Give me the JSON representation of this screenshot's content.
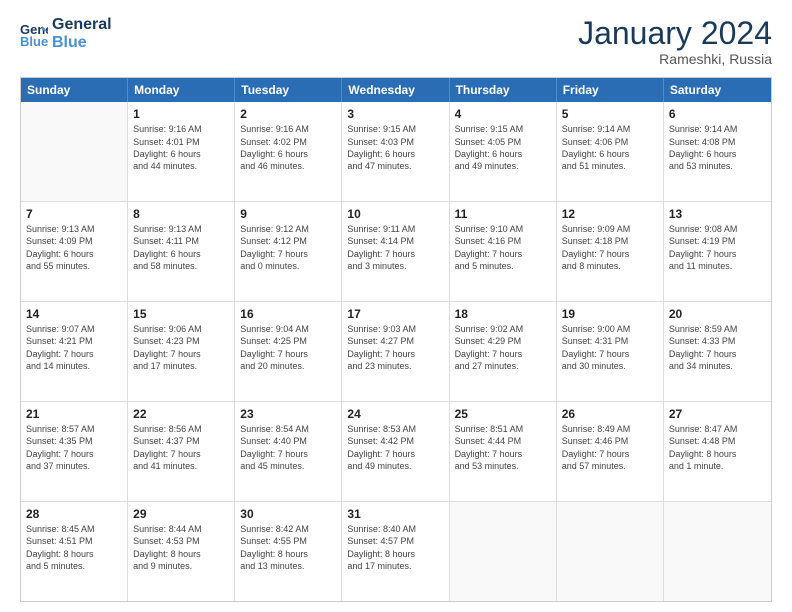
{
  "header": {
    "logo_line1": "General",
    "logo_line2": "Blue",
    "month": "January 2024",
    "location": "Rameshki, Russia"
  },
  "weekdays": [
    "Sunday",
    "Monday",
    "Tuesday",
    "Wednesday",
    "Thursday",
    "Friday",
    "Saturday"
  ],
  "weeks": [
    [
      {
        "day": "",
        "info": ""
      },
      {
        "day": "1",
        "info": "Sunrise: 9:16 AM\nSunset: 4:01 PM\nDaylight: 6 hours\nand 44 minutes."
      },
      {
        "day": "2",
        "info": "Sunrise: 9:16 AM\nSunset: 4:02 PM\nDaylight: 6 hours\nand 46 minutes."
      },
      {
        "day": "3",
        "info": "Sunrise: 9:15 AM\nSunset: 4:03 PM\nDaylight: 6 hours\nand 47 minutes."
      },
      {
        "day": "4",
        "info": "Sunrise: 9:15 AM\nSunset: 4:05 PM\nDaylight: 6 hours\nand 49 minutes."
      },
      {
        "day": "5",
        "info": "Sunrise: 9:14 AM\nSunset: 4:06 PM\nDaylight: 6 hours\nand 51 minutes."
      },
      {
        "day": "6",
        "info": "Sunrise: 9:14 AM\nSunset: 4:08 PM\nDaylight: 6 hours\nand 53 minutes."
      }
    ],
    [
      {
        "day": "7",
        "info": "Sunrise: 9:13 AM\nSunset: 4:09 PM\nDaylight: 6 hours\nand 55 minutes."
      },
      {
        "day": "8",
        "info": "Sunrise: 9:13 AM\nSunset: 4:11 PM\nDaylight: 6 hours\nand 58 minutes."
      },
      {
        "day": "9",
        "info": "Sunrise: 9:12 AM\nSunset: 4:12 PM\nDaylight: 7 hours\nand 0 minutes."
      },
      {
        "day": "10",
        "info": "Sunrise: 9:11 AM\nSunset: 4:14 PM\nDaylight: 7 hours\nand 3 minutes."
      },
      {
        "day": "11",
        "info": "Sunrise: 9:10 AM\nSunset: 4:16 PM\nDaylight: 7 hours\nand 5 minutes."
      },
      {
        "day": "12",
        "info": "Sunrise: 9:09 AM\nSunset: 4:18 PM\nDaylight: 7 hours\nand 8 minutes."
      },
      {
        "day": "13",
        "info": "Sunrise: 9:08 AM\nSunset: 4:19 PM\nDaylight: 7 hours\nand 11 minutes."
      }
    ],
    [
      {
        "day": "14",
        "info": "Sunrise: 9:07 AM\nSunset: 4:21 PM\nDaylight: 7 hours\nand 14 minutes."
      },
      {
        "day": "15",
        "info": "Sunrise: 9:06 AM\nSunset: 4:23 PM\nDaylight: 7 hours\nand 17 minutes."
      },
      {
        "day": "16",
        "info": "Sunrise: 9:04 AM\nSunset: 4:25 PM\nDaylight: 7 hours\nand 20 minutes."
      },
      {
        "day": "17",
        "info": "Sunrise: 9:03 AM\nSunset: 4:27 PM\nDaylight: 7 hours\nand 23 minutes."
      },
      {
        "day": "18",
        "info": "Sunrise: 9:02 AM\nSunset: 4:29 PM\nDaylight: 7 hours\nand 27 minutes."
      },
      {
        "day": "19",
        "info": "Sunrise: 9:00 AM\nSunset: 4:31 PM\nDaylight: 7 hours\nand 30 minutes."
      },
      {
        "day": "20",
        "info": "Sunrise: 8:59 AM\nSunset: 4:33 PM\nDaylight: 7 hours\nand 34 minutes."
      }
    ],
    [
      {
        "day": "21",
        "info": "Sunrise: 8:57 AM\nSunset: 4:35 PM\nDaylight: 7 hours\nand 37 minutes."
      },
      {
        "day": "22",
        "info": "Sunrise: 8:56 AM\nSunset: 4:37 PM\nDaylight: 7 hours\nand 41 minutes."
      },
      {
        "day": "23",
        "info": "Sunrise: 8:54 AM\nSunset: 4:40 PM\nDaylight: 7 hours\nand 45 minutes."
      },
      {
        "day": "24",
        "info": "Sunrise: 8:53 AM\nSunset: 4:42 PM\nDaylight: 7 hours\nand 49 minutes."
      },
      {
        "day": "25",
        "info": "Sunrise: 8:51 AM\nSunset: 4:44 PM\nDaylight: 7 hours\nand 53 minutes."
      },
      {
        "day": "26",
        "info": "Sunrise: 8:49 AM\nSunset: 4:46 PM\nDaylight: 7 hours\nand 57 minutes."
      },
      {
        "day": "27",
        "info": "Sunrise: 8:47 AM\nSunset: 4:48 PM\nDaylight: 8 hours\nand 1 minute."
      }
    ],
    [
      {
        "day": "28",
        "info": "Sunrise: 8:45 AM\nSunset: 4:51 PM\nDaylight: 8 hours\nand 5 minutes."
      },
      {
        "day": "29",
        "info": "Sunrise: 8:44 AM\nSunset: 4:53 PM\nDaylight: 8 hours\nand 9 minutes."
      },
      {
        "day": "30",
        "info": "Sunrise: 8:42 AM\nSunset: 4:55 PM\nDaylight: 8 hours\nand 13 minutes."
      },
      {
        "day": "31",
        "info": "Sunrise: 8:40 AM\nSunset: 4:57 PM\nDaylight: 8 hours\nand 17 minutes."
      },
      {
        "day": "",
        "info": ""
      },
      {
        "day": "",
        "info": ""
      },
      {
        "day": "",
        "info": ""
      }
    ]
  ]
}
